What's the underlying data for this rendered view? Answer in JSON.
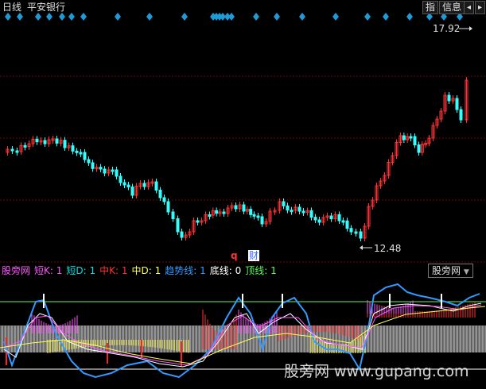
{
  "header": {
    "period": "日线",
    "stock_name": "平安银行",
    "btn_indicator": "指",
    "btn_info": "信息",
    "nav_left": "◂",
    "nav_right": "▸"
  },
  "price_pane": {
    "high_label": "17.92",
    "low_label": "12.48",
    "marker_q": "q",
    "marker_cai": "财"
  },
  "indicator_bar": {
    "name": "股旁网",
    "items": [
      {
        "label": "短K: 1",
        "color": "#ff55ff"
      },
      {
        "label": "短D: 1",
        "color": "#00e0e0"
      },
      {
        "label": "中K: 1",
        "color": "#ff3030"
      },
      {
        "label": "中D: 1",
        "color": "#ffff55"
      },
      {
        "label": "趋势线: 1",
        "color": "#3399ff"
      },
      {
        "label": "底线: 0",
        "color": "#ffffff"
      },
      {
        "label": "顶线: 1",
        "color": "#55ff55"
      }
    ],
    "right_button": "股旁网"
  },
  "watermark": "股旁网 www.gupang.com",
  "colors": {
    "up": "#ff3333",
    "down": "#33ffff",
    "grid": "#7a0000",
    "signal": "#1e9bd7"
  }
}
